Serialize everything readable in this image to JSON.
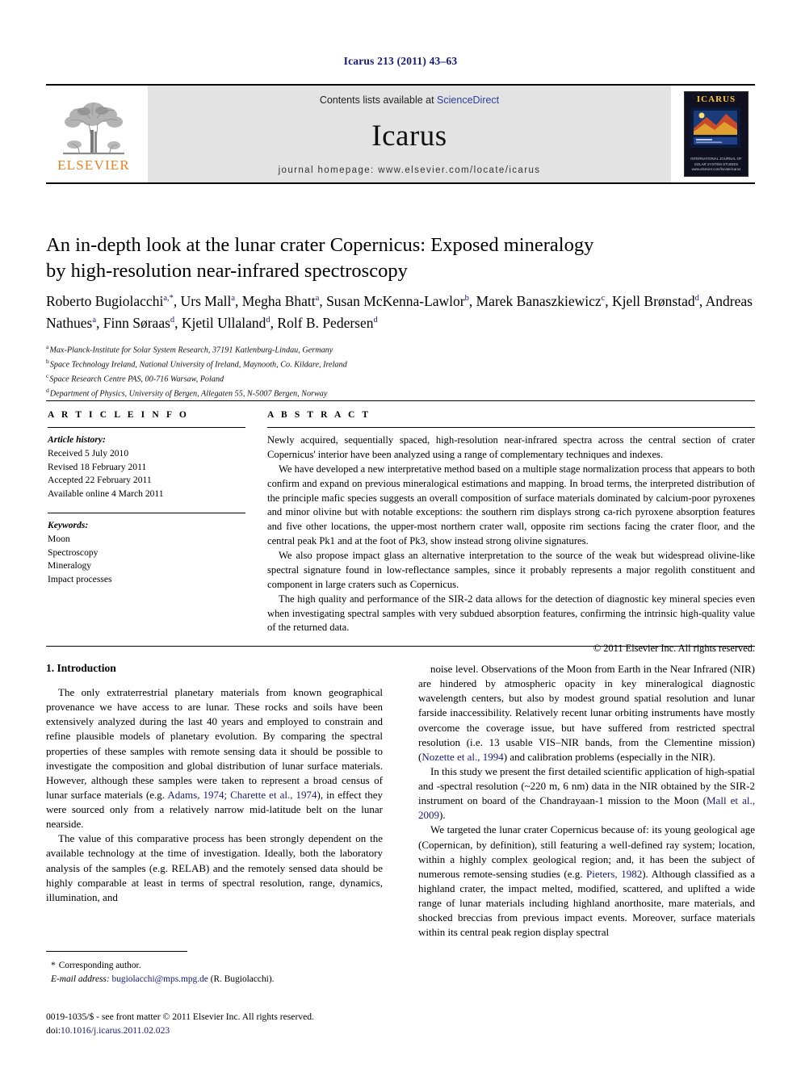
{
  "running_head": "Icarus 213 (2011) 43–63",
  "masthead": {
    "contents_prefix": "Contents lists available at ",
    "sciencedirect": "ScienceDirect",
    "journal_name": "Icarus",
    "homepage": "journal homepage: www.elsevier.com/locate/icarus",
    "publisher_wordmark": "ELSEVIER",
    "cover": {
      "title": "ICARUS",
      "caption_line1": "INTERNATIONAL JOURNAL OF SOLAR SYSTEM STUDIES",
      "caption_line2": "www.elsevier.com/locate/icarus"
    }
  },
  "article": {
    "title_line1": "An in-depth look at the lunar crater Copernicus: Exposed mineralogy",
    "title_line2": "by high-resolution near-infrared spectroscopy",
    "authors": [
      {
        "name": "Roberto Bugiolacchi",
        "marks": "a,*"
      },
      {
        "name": "Urs Mall",
        "marks": "a"
      },
      {
        "name": "Megha Bhatt",
        "marks": "a"
      },
      {
        "name": "Susan McKenna-Lawlor",
        "marks": "b"
      },
      {
        "name": "Marek Banaszkiewicz",
        "marks": "c"
      },
      {
        "name": "Kjell Brønstad",
        "marks": "d"
      },
      {
        "name": "Andreas Nathues",
        "marks": "a"
      },
      {
        "name": "Finn Søraas",
        "marks": "d"
      },
      {
        "name": "Kjetil Ullaland",
        "marks": "d"
      },
      {
        "name": "Rolf B. Pedersen",
        "marks": "d"
      }
    ],
    "affiliations": [
      {
        "mark": "a",
        "text": "Max-Planck-Institute for Solar System Research, 37191 Katlenburg-Lindau, Germany"
      },
      {
        "mark": "b",
        "text": "Space Technology Ireland, National University of Ireland, Maynooth, Co. Kildare, Ireland"
      },
      {
        "mark": "c",
        "text": "Space Research Centre PAS, 00-716 Warsaw, Poland"
      },
      {
        "mark": "d",
        "text": "Department of Physics, University of Bergen, Allegaten 55, N-5007 Bergen, Norway"
      }
    ]
  },
  "article_info": {
    "heading": "A R T I C L E    I N F O",
    "history_label": "Article history:",
    "history": [
      "Received 5 July 2010",
      "Revised 18 February 2011",
      "Accepted 22 February 2011",
      "Available online 4 March 2011"
    ],
    "keywords_label": "Keywords:",
    "keywords": [
      "Moon",
      "Spectroscopy",
      "Mineralogy",
      "Impact processes"
    ]
  },
  "abstract": {
    "heading": "A B S T R A C T",
    "paragraphs": [
      "Newly acquired, sequentially spaced, high-resolution near-infrared spectra across the central section of crater Copernicus' interior have been analyzed using a range of complementary techniques and indexes.",
      "We have developed a new interpretative method based on a multiple stage normalization process that appears to both confirm and expand on previous mineralogical estimations and mapping. In broad terms, the interpreted distribution of the principle mafic species suggests an overall composition of surface materials dominated by calcium-poor pyroxenes and minor olivine but with notable exceptions: the southern rim displays strong ca-rich pyroxene absorption features and five other locations, the upper-most northern crater wall, opposite rim sections facing the crater floor, and the central peak Pk1 and at the foot of Pk3, show instead strong olivine signatures.",
      "We also propose impact glass an alternative interpretation to the source of the weak but widespread olivine-like spectral signature found in low-reflectance samples, since it probably represents a major regolith constituent and component in large craters such as Copernicus.",
      "The high quality and performance of the SIR-2 data allows for the detection of diagnostic key mineral species even when investigating spectral samples with very subdued absorption features, confirming the intrinsic high-quality value of the returned data."
    ],
    "copyright": "© 2011 Elsevier Inc. All rights reserved."
  },
  "body": {
    "section_number_title": "1. Introduction",
    "left_column": [
      "The only extraterrestrial planetary materials from known geographical provenance we have access to are lunar. These rocks and soils have been extensively analyzed during the last 40 years and employed to constrain and refine plausible models of planetary evolution. By comparing the spectral properties of these samples with remote sensing data it should be possible to investigate the composition and global distribution of lunar surface materials. However, although these samples were taken to represent a broad census of lunar surface materials (e.g. Adams, 1974; Charette et al., 1974), in effect they were sourced only from a relatively narrow mid-latitude belt on the lunar nearside.",
      "The value of this comparative process has been strongly dependent on the available technology at the time of investigation. Ideally, both the laboratory analysis of the samples (e.g. RELAB) and the remotely sensed data should be highly comparable at least in terms of spectral resolution, range, dynamics, illumination, and"
    ],
    "left_citations": [
      "Adams, 1974; Charette et al., 1974"
    ],
    "right_column": [
      "noise level. Observations of the Moon from Earth in the Near Infrared (NIR) are hindered by atmospheric opacity in key mineralogical diagnostic wavelength centers, but also by modest ground spatial resolution and lunar farside inaccessibility. Relatively recent lunar orbiting instruments have mostly overcome the coverage issue, but have suffered from restricted spectral resolution (i.e. 13 usable VIS–NIR bands, from the Clementine mission) (Nozette et al., 1994) and calibration problems (especially in the NIR).",
      "In this study we present the first detailed scientific application of high-spatial and -spectral resolution (~220 m, 6 nm) data in the NIR obtained by the SIR-2 instrument on board of the Chandrayaan-1 mission to the Moon (Mall et al., 2009).",
      "We targeted the lunar crater Copernicus because of: its young geological age (Copernican, by definition), still featuring a well-defined ray system; location, within a highly complex geological region; and, it has been the subject of numerous remote-sensing studies (e.g. Pieters, 1982). Although classified as a highland crater, the impact melted, modified, scattered, and uplifted a wide range of lunar materials including highland anorthosite, mare materials, and shocked breccias from previous impact events. Moreover, surface materials within its central peak region display spectral"
    ],
    "right_citations": [
      "Nozette et al., 1994",
      "Mall et al., 2009",
      "Pieters, 1982"
    ]
  },
  "footnotes": {
    "corresponding_marker": "*",
    "corresponding_label": "Corresponding author.",
    "email_label": "E-mail address:",
    "email": "bugiolacchi@mps.mpg.de",
    "email_owner": "(R. Bugiolacchi)."
  },
  "imprint": {
    "line1": "0019-1035/$ - see front matter © 2011 Elsevier Inc. All rights reserved.",
    "doi_label": "doi:",
    "doi": "10.1016/j.icarus.2011.02.023"
  },
  "colors": {
    "link_blue": "#16197a",
    "sciencedirect_blue": "#2a3ea0",
    "elsevier_orange": "#f08020",
    "band_grey": "#e3e3e3"
  }
}
